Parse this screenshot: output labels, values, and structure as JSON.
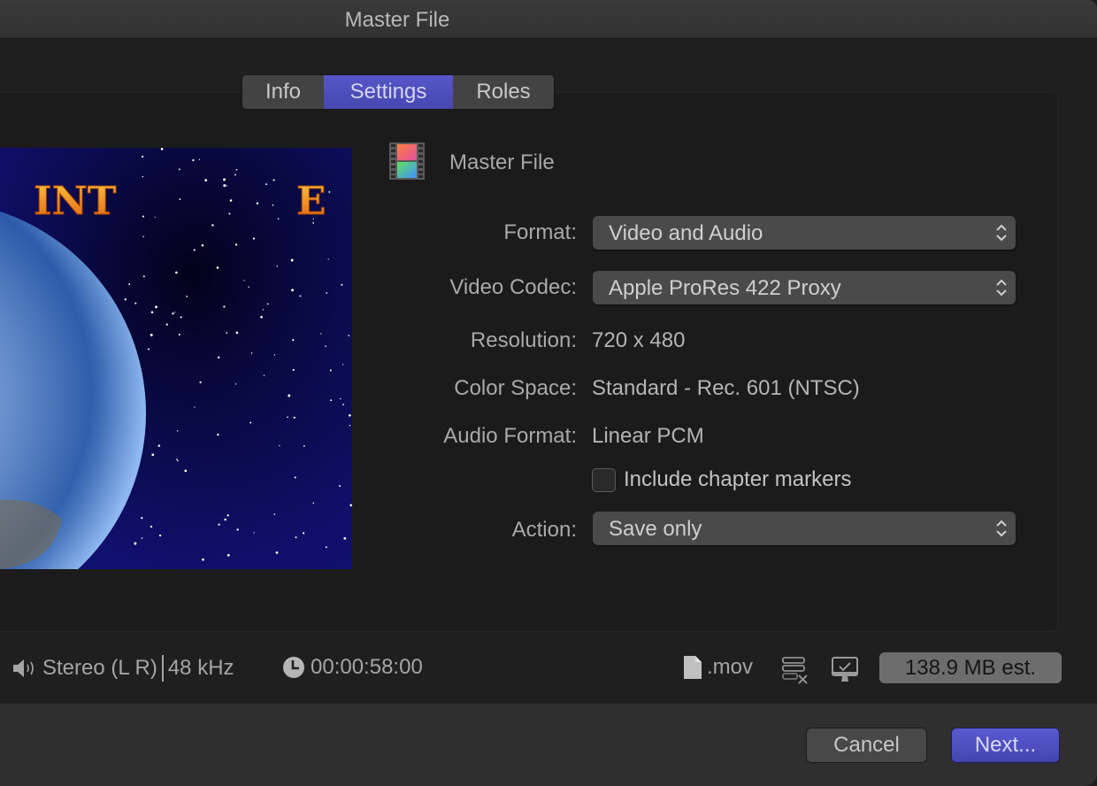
{
  "window": {
    "title": "Master File"
  },
  "tabs": [
    {
      "label": "Info",
      "selected": false
    },
    {
      "label": "Settings",
      "selected": true
    },
    {
      "label": "Roles",
      "selected": false
    }
  ],
  "preview": {
    "title_fragments": [
      "INT",
      "E"
    ],
    "icon": "earth-space-thumbnail"
  },
  "destination": {
    "icon": "film-strip-icon",
    "name": "Master File"
  },
  "form": {
    "format": {
      "label": "Format:",
      "value": "Video and Audio"
    },
    "video_codec": {
      "label": "Video Codec:",
      "value": "Apple ProRes 422 Proxy"
    },
    "resolution": {
      "label": "Resolution:",
      "value": "720 x 480"
    },
    "color_space": {
      "label": "Color Space:",
      "value": "Standard - Rec. 601 (NTSC)"
    },
    "audio_format": {
      "label": "Audio Format:",
      "value": "Linear PCM"
    },
    "chapter_markers": {
      "label": "Include chapter markers",
      "checked": false
    },
    "action": {
      "label": "Action:",
      "value": "Save only"
    }
  },
  "status": {
    "audio_channels": "Stereo (L R)",
    "sample_rate": "48 kHz",
    "duration": "00:00:58:00",
    "extension": ".mov",
    "estimated_size": "138.9 MB est."
  },
  "buttons": {
    "cancel": "Cancel",
    "next": "Next..."
  },
  "colors": {
    "accent": "#4f4fc0",
    "background": "#1f1f1f",
    "panel": "#1b1b1b"
  }
}
